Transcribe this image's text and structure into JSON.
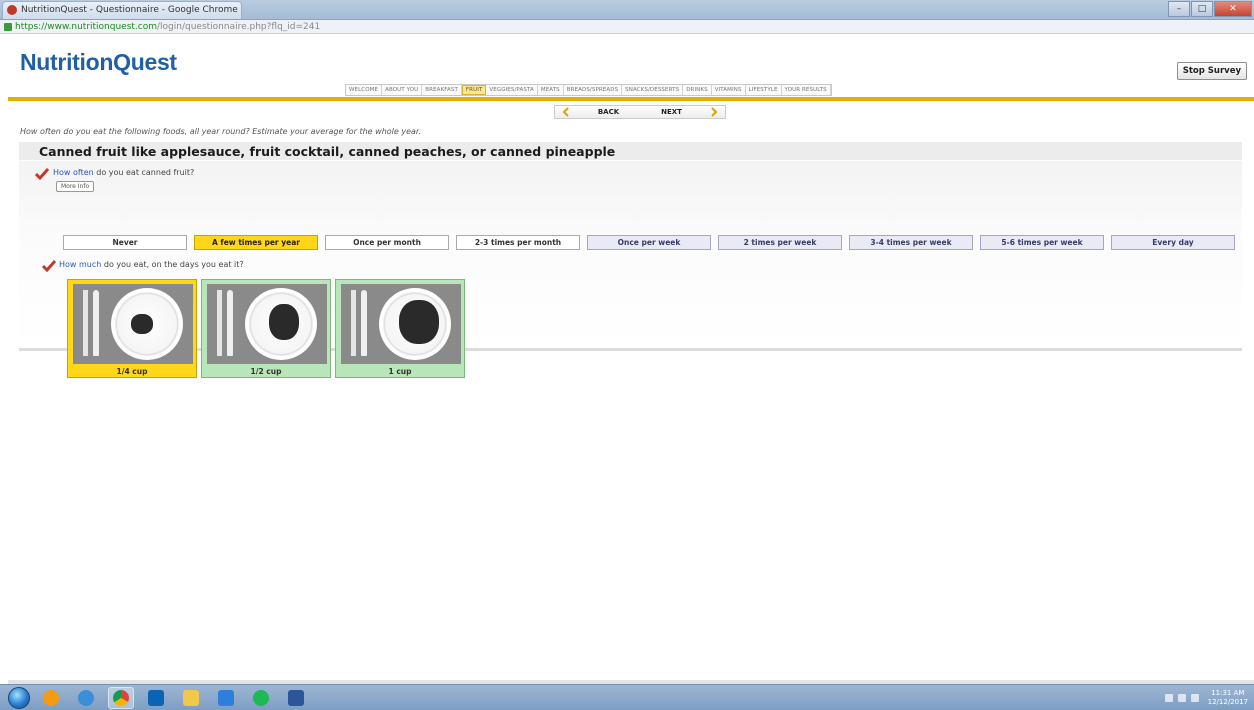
{
  "browser": {
    "tab_title": "NutritionQuest - Questionnaire - Google Chrome",
    "url_secure": "https://www.nutritionquest.com",
    "url_path": "/login/questionnaire.php?flq_id=241",
    "controls": {
      "minimize": "–",
      "maximize": "□",
      "close": "✕"
    }
  },
  "header": {
    "logo": "NutritionQuest",
    "stop_survey_label": "Stop Survey",
    "nav_items": [
      "WELCOME",
      "ABOUT YOU",
      "BREAKFAST",
      "FRUIT",
      "VEGGIES/PASTA",
      "MEATS",
      "BREADS/SPREADS",
      "SNACKS/DESSERTS",
      "DRINKS",
      "VITAMINS",
      "LIFESTYLE",
      "YOUR RESULTS"
    ],
    "active_nav": "FRUIT"
  },
  "navigation": {
    "back_label": "BACK",
    "next_label": "NEXT"
  },
  "main": {
    "instructions": "How often do you eat the following foods, all year round? Estimate your average for the whole year.",
    "food_title": "Canned fruit like applesauce, fruit cocktail, canned peaches, or canned pineapple",
    "q1_highlight": "How often",
    "q1_rest": " do you eat canned fruit?",
    "more_info_label": "More Info",
    "frequency_options": [
      "Never",
      "A few times per year",
      "Once per month",
      "2-3 times per month",
      "Once per week",
      "2 times per week",
      "3-4 times per week",
      "5-6 times per week",
      "Every day"
    ],
    "selected_frequency": "A few times per year",
    "q2_highlight": "How much",
    "q2_rest": " do you eat, on the days you eat it?",
    "portions": [
      "1/4 cup",
      "1/2 cup",
      "1 cup"
    ],
    "selected_portion": "1/4 cup"
  },
  "colors": {
    "brand_blue": "#1f5fa8",
    "accent_yellow": "#ffd619",
    "header_rule": "#e0b000",
    "portion_green": "#b8e6b8"
  },
  "taskbar": {
    "apps": [
      "windows-explorer-icon",
      "media-player-icon",
      "internet-explorer-icon",
      "chrome-icon",
      "outlook-icon",
      "file-explorer-icon",
      "dropbox-icon",
      "spotify-icon",
      "word-icon"
    ],
    "clock_time": "11:31 AM",
    "clock_date": "12/12/2017"
  }
}
